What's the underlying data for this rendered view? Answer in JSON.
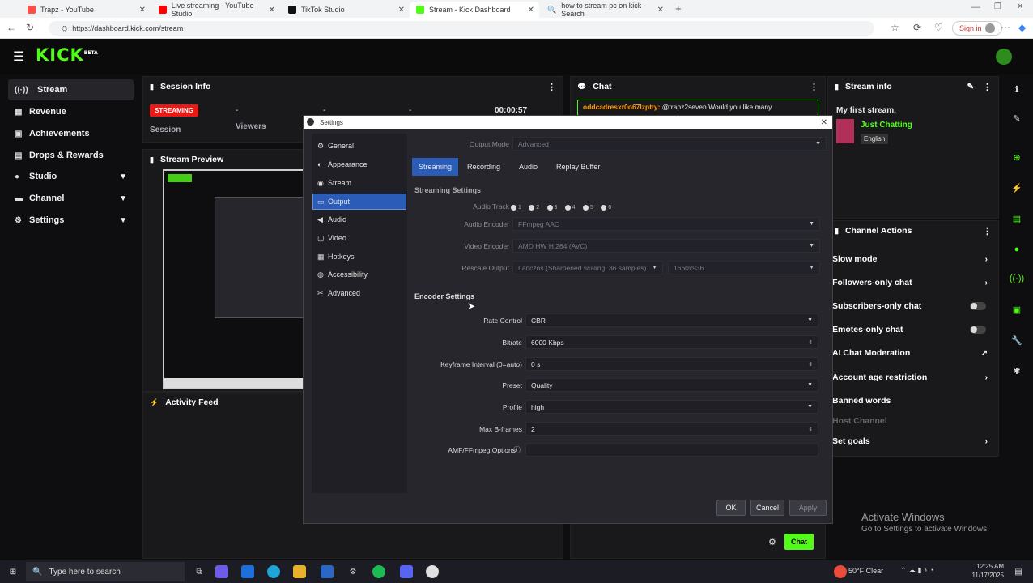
{
  "browser": {
    "tabs": [
      {
        "label": "Trapz - YouTube",
        "color": "#ff4e45"
      },
      {
        "label": "Live streaming - YouTube Studio",
        "color": "#ff0000"
      },
      {
        "label": "TikTok Studio",
        "color": "#111111"
      },
      {
        "label": "Stream - Kick Dashboard",
        "color": "#53fc18"
      },
      {
        "label": "how to stream pc on kick - Search",
        "color": "#3b82f6"
      }
    ],
    "url": "https://dashboard.kick.com/stream",
    "signin_label": "Sign in"
  },
  "kick": {
    "logo": "KICK",
    "logo_badge": "BETA",
    "accent": "#53fc18"
  },
  "sidebar": {
    "items": [
      {
        "label": "Stream",
        "icon": "stream-icon"
      },
      {
        "label": "Revenue",
        "icon": "dollar-icon"
      },
      {
        "label": "Achievements",
        "icon": "trophy-icon"
      },
      {
        "label": "Drops & Rewards",
        "icon": "gift-icon"
      },
      {
        "label": "Studio",
        "icon": "studio-icon"
      },
      {
        "label": "Channel",
        "icon": "channel-icon"
      },
      {
        "label": "Settings",
        "icon": "gear-icon"
      }
    ]
  },
  "session": {
    "title": "Session Info",
    "status": "STREAMING",
    "session_label": "Session",
    "dash1": "-",
    "viewers_label": "Viewers",
    "dash2": "-",
    "dash3": "-",
    "timer": "00:00:57"
  },
  "preview": {
    "title": "Stream Preview"
  },
  "activity": {
    "title": "Activity Feed"
  },
  "chat": {
    "title": "Chat",
    "user": "oddcadresxr0o67lzptty:",
    "message": "@trapz2seven Would you like many",
    "send_label": "Chat"
  },
  "stream_info": {
    "title": "Stream info",
    "stream_title": "My first stream.",
    "category": "Just Chatting",
    "language": "English"
  },
  "channel_actions": {
    "title": "Channel Actions",
    "items": [
      {
        "label": "Slow mode",
        "control": "arrow"
      },
      {
        "label": "Followers-only chat",
        "control": "arrow"
      },
      {
        "label": "Subscribers-only chat",
        "control": "toggle"
      },
      {
        "label": "Emotes-only chat",
        "control": "toggle"
      },
      {
        "label": "AI Chat Moderation",
        "control": "external"
      },
      {
        "label": "Account age restriction",
        "control": "arrow"
      },
      {
        "label": "Banned words",
        "control": "none"
      },
      {
        "label": "Host Channel",
        "control": "none",
        "disabled": true
      },
      {
        "label": "Set goals",
        "control": "arrow"
      }
    ]
  },
  "settings": {
    "title": "Settings",
    "nav": [
      "General",
      "Appearance",
      "Stream",
      "Output",
      "Audio",
      "Video",
      "Hotkeys",
      "Accessibility",
      "Advanced"
    ],
    "active_nav": "Output",
    "output_mode_label": "Output Mode",
    "output_mode_value": "Advanced",
    "tabs": [
      "Streaming",
      "Recording",
      "Audio",
      "Replay Buffer"
    ],
    "streaming_settings_title": "Streaming Settings",
    "audio_track_label": "Audio Track",
    "audio_tracks": [
      "1",
      "2",
      "3",
      "4",
      "5",
      "6"
    ],
    "audio_encoder_label": "Audio Encoder",
    "audio_encoder_value": "FFmpeg AAC",
    "video_encoder_label": "Video Encoder",
    "video_encoder_value": "AMD HW H.264 (AVC)",
    "rescale_label": "Rescale Output",
    "rescale_value": "Lanczos (Sharpened scaling, 36 samples)",
    "rescale_res": "1660x936",
    "encoder_settings_title": "Encoder Settings",
    "fields": [
      {
        "label": "Rate Control",
        "value": "CBR",
        "kind": "select"
      },
      {
        "label": "Bitrate",
        "value": "6000 Kbps",
        "kind": "spin"
      },
      {
        "label": "Keyframe Interval (0=auto)",
        "value": "0 s",
        "kind": "spin"
      },
      {
        "label": "Preset",
        "value": "Quality",
        "kind": "select"
      },
      {
        "label": "Profile",
        "value": "high",
        "kind": "select"
      },
      {
        "label": "Max B-frames",
        "value": "2",
        "kind": "spin"
      },
      {
        "label": "AMF/FFmpeg Options",
        "value": "",
        "kind": "text"
      }
    ],
    "ok_label": "OK",
    "cancel_label": "Cancel",
    "apply_label": "Apply"
  },
  "watermark": {
    "line1": "Activate Windows",
    "line2": "Go to Settings to activate Windows."
  },
  "taskbar": {
    "search_placeholder": "Type here to search",
    "weather": "50°F  Clear",
    "time": "12:25 AM",
    "date": "11/17/2025"
  }
}
